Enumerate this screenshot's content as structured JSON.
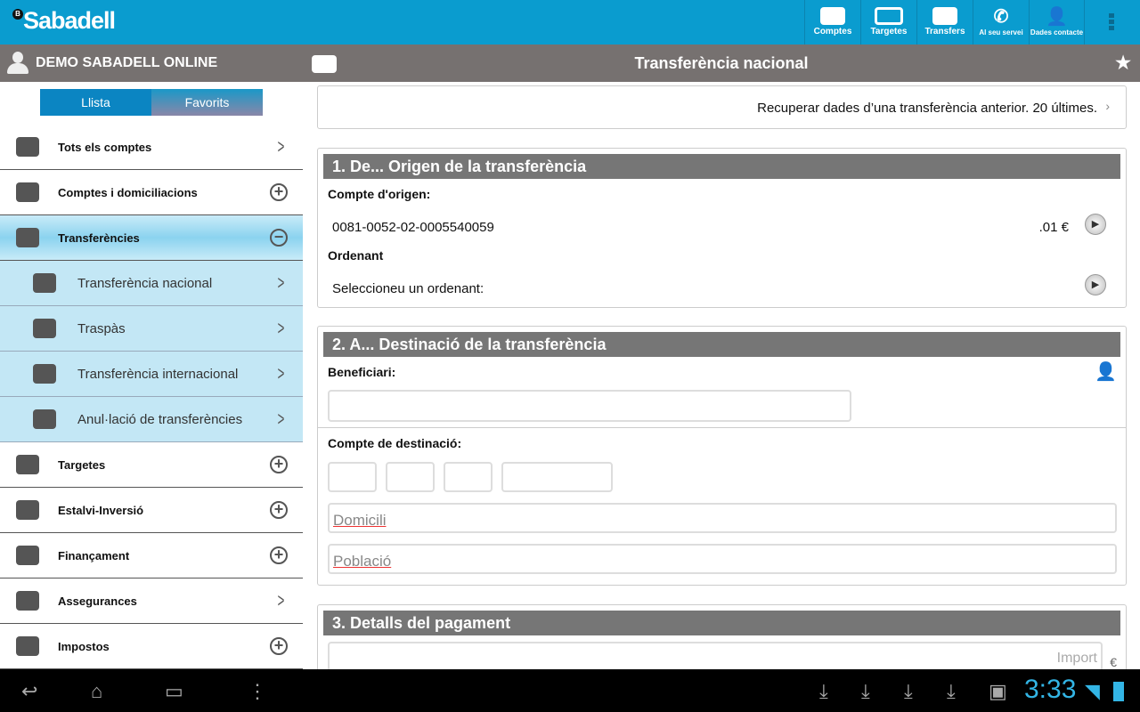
{
  "brand": {
    "name": "Sabadell",
    "badge": "B"
  },
  "toolbar": [
    {
      "label": "Comptes",
      "icon": "briefcase-icon"
    },
    {
      "label": "Targetes",
      "icon": "card-icon"
    },
    {
      "label": "Transfers",
      "icon": "transfer-icon"
    },
    {
      "label": "Al seu servei",
      "icon": "phone-icon"
    },
    {
      "label": "Dades contacte",
      "icon": "person-icon"
    }
  ],
  "user": "DEMO SABADELL ONLINE",
  "title": "Transferència nacional",
  "tabs": [
    "Llista",
    "Favorits"
  ],
  "sidebar": [
    {
      "label": "Tots els comptes",
      "action": "chevron"
    },
    {
      "label": "Comptes i domiciliacions",
      "action": "plus"
    },
    {
      "label": "Transferències",
      "action": "minus"
    },
    {
      "label": "Transferència nacional",
      "action": "chevron"
    },
    {
      "label": "Traspàs",
      "action": "chevron"
    },
    {
      "label": "Transferència internacional",
      "action": "chevron"
    },
    {
      "label": "Anul·lació de transferències",
      "action": "chevron"
    },
    {
      "label": "Targetes",
      "action": "plus"
    },
    {
      "label": "Estalvi-Inversió",
      "action": "plus"
    },
    {
      "label": "Finançament",
      "action": "plus"
    },
    {
      "label": "Assegurances",
      "action": "chevron"
    },
    {
      "label": "Impostos",
      "action": "plus"
    }
  ],
  "recover": "Recuperar dades d’una transferència anterior. 20 últimes.",
  "s1": {
    "title": "1. De... Origen de la transferència",
    "origin_label": "Compte d'origen:",
    "account": "0081-0052-02-0005540059",
    "balance": ".01 €",
    "ordenant_label": "Ordenant",
    "ordenant_select": "Seleccioneu un ordenant:"
  },
  "s2": {
    "title": "2. A... Destinació de la transferència",
    "beneficiari": "Beneficiari:",
    "compte": "Compte de destinació:",
    "domicili": "Domicili",
    "poblacio": "Població"
  },
  "s3": {
    "title": "3. Detalls del pagament",
    "import": "Import",
    "currency": "€"
  },
  "status": {
    "time": "3:33"
  }
}
